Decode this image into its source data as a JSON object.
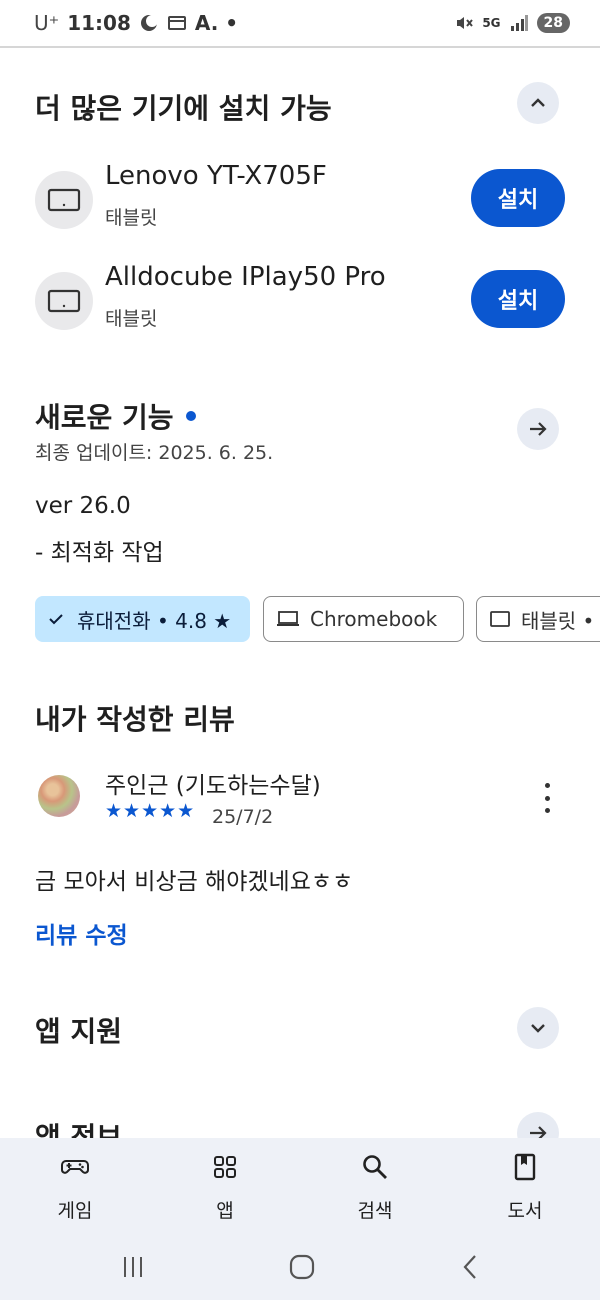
{
  "status_bar": {
    "carrier": "U⁺",
    "time": "11:08",
    "extra": "A.  •",
    "network": "5G",
    "battery": "28"
  },
  "install_section": {
    "title": "더 많은 기기에 설치 가능",
    "devices": [
      {
        "name": "Lenovo YT-X705F",
        "type": "태블릿",
        "button": "설치"
      },
      {
        "name": "Alldocube IPlay50 Pro",
        "type": "태블릿",
        "button": "설치"
      }
    ]
  },
  "whats_new": {
    "title": "새로운 기능",
    "updated": "최종 업데이트: 2025. 6. 25.",
    "version": "ver 26.0",
    "note": "- 최적화 작업"
  },
  "chips": [
    {
      "label": "휴대전화 • 4.8 ★",
      "selected": true
    },
    {
      "label": "Chromebook",
      "selected": false
    },
    {
      "label": "태블릿 •",
      "selected": false
    }
  ],
  "my_review": {
    "title": "내가 작성한 리뷰",
    "author": "주인근 (기도하는수달)",
    "stars": "★★★★★",
    "rating": 5,
    "date": "25/7/2",
    "text": "금 모아서 비상금 해야겠네요ㅎㅎ",
    "edit_label": "리뷰 수정"
  },
  "app_support": {
    "title": "앱 지원"
  },
  "app_info": {
    "title": "앱 정보"
  },
  "bottom_nav": [
    {
      "label": "게임",
      "icon": "gamepad-icon"
    },
    {
      "label": "앱",
      "icon": "apps-grid-icon"
    },
    {
      "label": "검색",
      "icon": "search-icon"
    },
    {
      "label": "도서",
      "icon": "book-icon"
    }
  ],
  "colors": {
    "accent": "#0b57d0",
    "chip_selected": "#c2e7ff",
    "nav_bg": "#eef1f7"
  }
}
